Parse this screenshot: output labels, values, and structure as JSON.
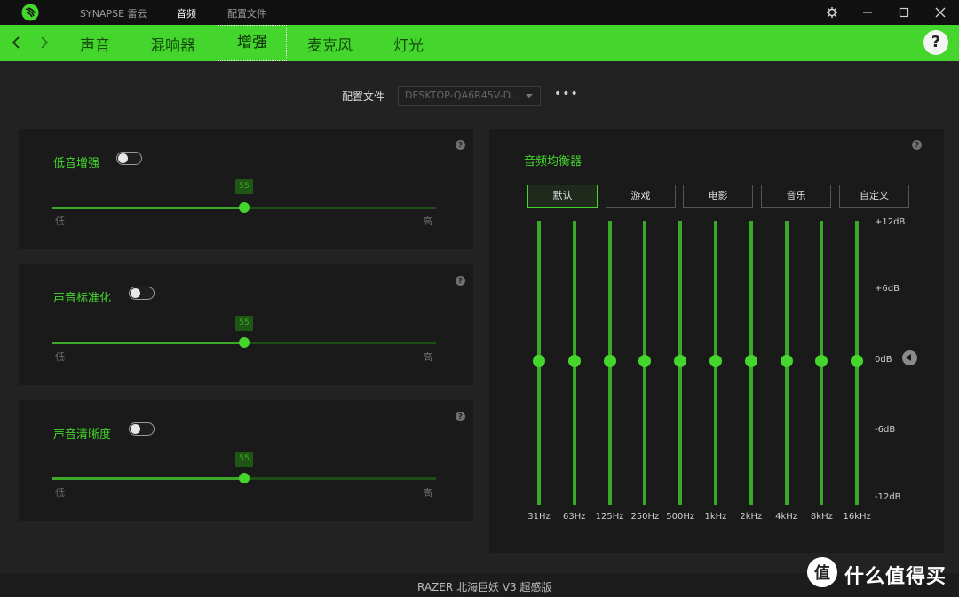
{
  "titlebar": {
    "app_name": "SYNAPSE 雷云",
    "nav": [
      "音频",
      "配置文件"
    ]
  },
  "tabs": [
    "声音",
    "混响器",
    "增强",
    "麦克风",
    "灯光"
  ],
  "active_tab": "增强",
  "help": "?",
  "profile": {
    "label": "配置文件",
    "value": "DESKTOP-QA6R45V-D...",
    "more": "•••"
  },
  "enhancements": [
    {
      "title": "低音增强",
      "enabled": false,
      "value": 55,
      "value_text": "55",
      "min_label": "低",
      "max_label": "高",
      "min": 0,
      "max": 100
    },
    {
      "title": "声音标准化",
      "enabled": false,
      "value": 55,
      "value_text": "55",
      "min_label": "低",
      "max_label": "高",
      "min": 0,
      "max": 100
    },
    {
      "title": "声音清晰度",
      "enabled": false,
      "value": 55,
      "value_text": "55",
      "min_label": "低",
      "max_label": "高",
      "min": 0,
      "max": 100
    }
  ],
  "equalizer": {
    "title": "音频均衡器",
    "presets": [
      "默认",
      "游戏",
      "电影",
      "音乐",
      "自定义"
    ],
    "active_preset": "默认",
    "db_labels": [
      "+12dB",
      "+6dB",
      "0dB",
      "-6dB",
      "-12dB"
    ],
    "bands": [
      {
        "freq": "31Hz",
        "gain_db": 0
      },
      {
        "freq": "63Hz",
        "gain_db": 0
      },
      {
        "freq": "125Hz",
        "gain_db": 0
      },
      {
        "freq": "250Hz",
        "gain_db": 0
      },
      {
        "freq": "500Hz",
        "gain_db": 0
      },
      {
        "freq": "1kHz",
        "gain_db": 0
      },
      {
        "freq": "2kHz",
        "gain_db": 0
      },
      {
        "freq": "4kHz",
        "gain_db": 0
      },
      {
        "freq": "8kHz",
        "gain_db": 0
      },
      {
        "freq": "16kHz",
        "gain_db": 0
      }
    ]
  },
  "device_name": "RAZER 北海巨妖 V3 超感版",
  "watermark": "什么值得买",
  "colors": {
    "accent": "#44d62c",
    "background": "#222222",
    "panel": "#1a1a1a"
  }
}
